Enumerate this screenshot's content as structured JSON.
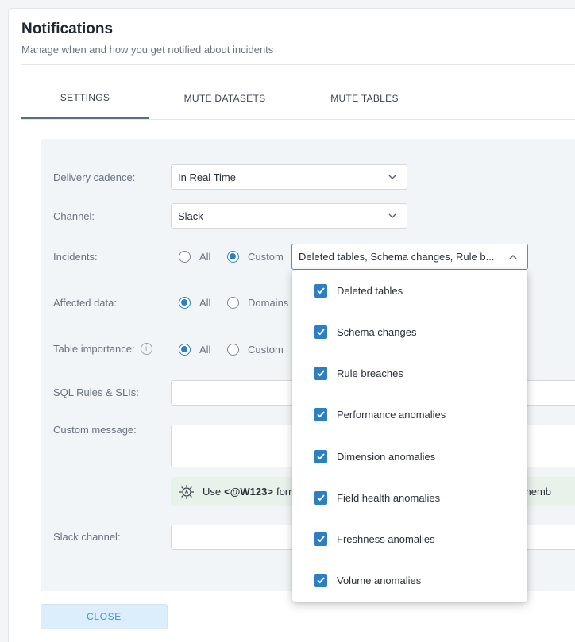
{
  "header": {
    "title": "Notifications",
    "subtitle": "Manage when and how you get notified about incidents"
  },
  "tabs": [
    {
      "label": "SETTINGS",
      "active": true
    },
    {
      "label": "MUTE DATASETS",
      "active": false
    },
    {
      "label": "MUTE TABLES",
      "active": false
    }
  ],
  "form": {
    "delivery_cadence": {
      "label": "Delivery cadence:",
      "value": "In Real Time"
    },
    "channel": {
      "label": "Channel:",
      "value": "Slack"
    },
    "incidents": {
      "label": "Incidents:",
      "options": [
        "All",
        "Custom"
      ],
      "selected": "Custom",
      "multiselect_value": "Deleted tables, Schema changes, Rule b..."
    },
    "affected_data": {
      "label": "Affected data:",
      "options": [
        "All",
        "Domains"
      ],
      "selected": "All"
    },
    "table_importance": {
      "label": "Table importance:",
      "info_icon": "i",
      "options": [
        "All",
        "Custom"
      ],
      "selected": "All"
    },
    "sql_rules": {
      "label": "SQL Rules & SLIs:",
      "value": ""
    },
    "custom_message": {
      "label": "Custom message:",
      "value": ""
    },
    "hint": {
      "prefix": "Use",
      "code": "<@W123>",
      "middle": "form",
      "suffix": "ing memb"
    },
    "slack_channel": {
      "label": "Slack channel:",
      "value": ""
    }
  },
  "dropdown": {
    "items": [
      {
        "label": "Deleted tables",
        "checked": true
      },
      {
        "label": "Schema changes",
        "checked": true
      },
      {
        "label": "Rule breaches",
        "checked": true
      },
      {
        "label": "Performance anomalies",
        "checked": true
      },
      {
        "label": "Dimension anomalies",
        "checked": true
      },
      {
        "label": "Field health anomalies",
        "checked": true
      },
      {
        "label": "Freshness anomalies",
        "checked": true
      },
      {
        "label": "Volume anomalies",
        "checked": true
      }
    ]
  },
  "footer": {
    "close_label": "CLOSE"
  },
  "colors": {
    "accent": "#2d7fc4",
    "panel": "#f2f5f7",
    "hint_bg": "#e7f2ea"
  }
}
